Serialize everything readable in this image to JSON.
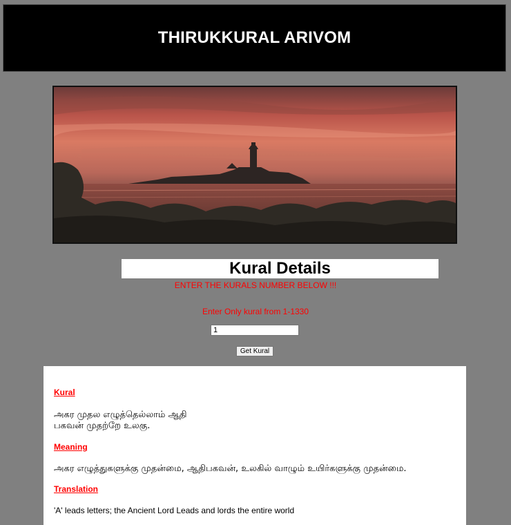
{
  "header": {
    "title": "THIRUKKURAL ARIVOM"
  },
  "hero": {
    "image_icon": "sunset-statue-image"
  },
  "details": {
    "title": "Kural Details",
    "instruction": "ENTER THE KURALS NUMBER BELOW !!!",
    "range_note": "Enter Only kural from 1-1330",
    "input_value": "1",
    "button_label": "Get Kural"
  },
  "result": {
    "kural_label": "Kural",
    "kural_line_1": "அகர முதல எழுத்தெல்லாம் ஆதி",
    "kural_line_2": "பகவன் முதற்றே உலகு.",
    "meaning_label": "Meaning",
    "meaning_text": "அகர எழுத்துகளுக்கு முதன்மை, ஆதிபகவன், உலகில் வாழும் உயிர்களுக்கு முதன்மை.",
    "translation_label": "Translation",
    "translation_text": "'A' leads letters; the Ancient Lord Leads and lords the entire world"
  },
  "colors": {
    "page_background": "#808080",
    "header_background": "#000000",
    "accent_red": "#ff0000"
  }
}
